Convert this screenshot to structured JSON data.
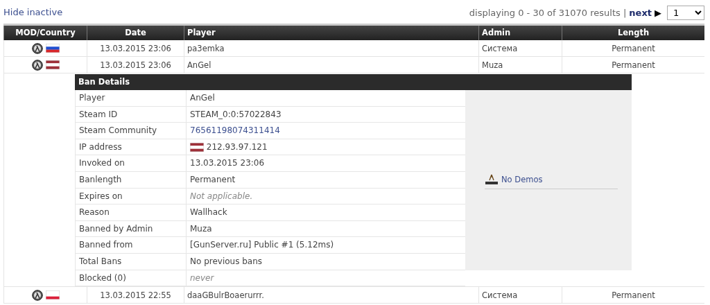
{
  "filter_link": "Hide inactive",
  "pagination": {
    "summary": "displaying 0 - 30 of 31070 results |",
    "next": "next",
    "next_arrow": "▶",
    "page": "1"
  },
  "table": {
    "columns": [
      {
        "label": "MOD/Country"
      },
      {
        "label": "Date"
      },
      {
        "label": "Player"
      },
      {
        "label": "Admin"
      },
      {
        "label": "Length"
      }
    ],
    "rows": [
      {
        "kind": "russia",
        "date": "13.03.2015 23:06",
        "player": "pa3emka",
        "admin": "Система",
        "length": "Permanent"
      },
      {
        "kind": "latvia",
        "date": "13.03.2015 23:06",
        "player": "AnGel",
        "admin": "Muza",
        "length": "Permanent",
        "details": {
          "title": "Ban Details",
          "demos": "No Demos",
          "fields": [
            {
              "label": "Player",
              "value": "AnGel",
              "kind": "plain"
            },
            {
              "label": "Steam ID",
              "value": "STEAM_0:0:57022843",
              "kind": "plain"
            },
            {
              "label": "Steam Community",
              "value": "76561198074311414",
              "kind": "link"
            },
            {
              "label": "IP address",
              "value": "212.93.97.121",
              "kind": "flag",
              "flag": {
                "kind": "latvia"
              }
            },
            {
              "label": "Invoked on",
              "value": "13.03.2015 23:06",
              "kind": "plain"
            },
            {
              "label": "Banlength",
              "value": "Permanent",
              "kind": "plain"
            },
            {
              "label": "Expires on",
              "value": "Not applicable.",
              "kind": "muted"
            },
            {
              "label": "Reason",
              "value": "Wallhack",
              "kind": "plain"
            },
            {
              "label": "Banned by Admin",
              "value": "Muza",
              "kind": "plain"
            },
            {
              "label": "Banned from",
              "value": "[GunServer.ru] Public #1 (5.12ms)",
              "kind": "plain"
            },
            {
              "label": "Total Bans",
              "value": "No previous bans",
              "kind": "plain"
            },
            {
              "label": "Blocked (0)",
              "value": "never",
              "kind": "muted"
            }
          ]
        }
      },
      {
        "kind": "poland",
        "date": "13.03.2015 22:55",
        "player": "daaGBulrBoaerurrr.",
        "admin": "Система",
        "length": "Permanent"
      }
    ]
  }
}
